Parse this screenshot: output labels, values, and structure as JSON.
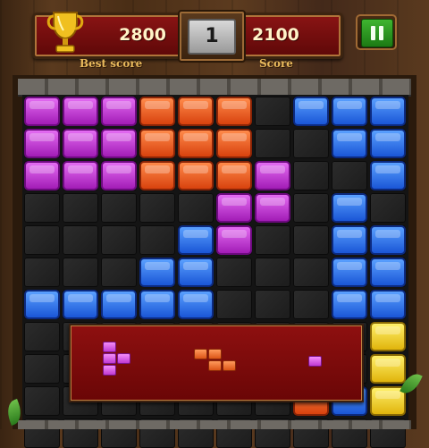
{
  "header": {
    "best_score": "2800",
    "best_label": "Best score",
    "score": "2100",
    "score_label": "Score",
    "level": "1",
    "trophy_icon": "trophy-icon",
    "pause_icon": "pause-icon"
  },
  "colors": {
    "purple": "#c03ad2",
    "orange": "#e85a1e",
    "blue": "#2a6ae6",
    "yellow": "#f0c820",
    "board": "#1c1c1c"
  },
  "board": {
    "columns": 10,
    "rows": 11,
    "blocks": [
      {
        "r": 0,
        "c": 0,
        "color": "purple"
      },
      {
        "r": 0,
        "c": 1,
        "color": "purple"
      },
      {
        "r": 0,
        "c": 2,
        "color": "purple"
      },
      {
        "r": 0,
        "c": 3,
        "color": "orange"
      },
      {
        "r": 0,
        "c": 4,
        "color": "orange"
      },
      {
        "r": 0,
        "c": 5,
        "color": "orange"
      },
      {
        "r": 0,
        "c": 7,
        "color": "blue"
      },
      {
        "r": 0,
        "c": 8,
        "color": "blue"
      },
      {
        "r": 0,
        "c": 9,
        "color": "blue"
      },
      {
        "r": 1,
        "c": 0,
        "color": "purple"
      },
      {
        "r": 1,
        "c": 1,
        "color": "purple"
      },
      {
        "r": 1,
        "c": 2,
        "color": "purple"
      },
      {
        "r": 1,
        "c": 3,
        "color": "orange"
      },
      {
        "r": 1,
        "c": 4,
        "color": "orange"
      },
      {
        "r": 1,
        "c": 5,
        "color": "orange"
      },
      {
        "r": 1,
        "c": 8,
        "color": "blue"
      },
      {
        "r": 1,
        "c": 9,
        "color": "blue"
      },
      {
        "r": 2,
        "c": 0,
        "color": "purple"
      },
      {
        "r": 2,
        "c": 1,
        "color": "purple"
      },
      {
        "r": 2,
        "c": 2,
        "color": "purple"
      },
      {
        "r": 2,
        "c": 3,
        "color": "orange"
      },
      {
        "r": 2,
        "c": 4,
        "color": "orange"
      },
      {
        "r": 2,
        "c": 5,
        "color": "orange"
      },
      {
        "r": 2,
        "c": 6,
        "color": "purple"
      },
      {
        "r": 2,
        "c": 9,
        "color": "blue"
      },
      {
        "r": 3,
        "c": 5,
        "color": "purple"
      },
      {
        "r": 3,
        "c": 6,
        "color": "purple"
      },
      {
        "r": 3,
        "c": 8,
        "color": "blue"
      },
      {
        "r": 4,
        "c": 4,
        "color": "blue"
      },
      {
        "r": 4,
        "c": 5,
        "color": "purple"
      },
      {
        "r": 4,
        "c": 8,
        "color": "blue"
      },
      {
        "r": 4,
        "c": 9,
        "color": "blue"
      },
      {
        "r": 5,
        "c": 3,
        "color": "blue"
      },
      {
        "r": 5,
        "c": 4,
        "color": "blue"
      },
      {
        "r": 5,
        "c": 8,
        "color": "blue"
      },
      {
        "r": 5,
        "c": 9,
        "color": "blue"
      },
      {
        "r": 6,
        "c": 0,
        "color": "blue"
      },
      {
        "r": 6,
        "c": 1,
        "color": "blue"
      },
      {
        "r": 6,
        "c": 2,
        "color": "blue"
      },
      {
        "r": 6,
        "c": 3,
        "color": "blue"
      },
      {
        "r": 6,
        "c": 4,
        "color": "blue"
      },
      {
        "r": 6,
        "c": 8,
        "color": "blue"
      },
      {
        "r": 6,
        "c": 9,
        "color": "blue"
      },
      {
        "r": 7,
        "c": 9,
        "color": "yellow"
      },
      {
        "r": 8,
        "c": 9,
        "color": "yellow"
      },
      {
        "r": 9,
        "c": 9,
        "color": "yellow"
      },
      {
        "r": 9,
        "c": 8,
        "color": "blue"
      },
      {
        "r": 9,
        "c": 7,
        "color": "orange"
      }
    ]
  },
  "tray": {
    "pieces": [
      {
        "name": "piece-t-vertical",
        "color": "purple",
        "cells": [
          [
            0,
            0
          ],
          [
            1,
            0
          ],
          [
            1,
            1
          ],
          [
            2,
            0
          ]
        ]
      },
      {
        "name": "piece-z",
        "color": "orange",
        "cells": [
          [
            0,
            0
          ],
          [
            0,
            1
          ],
          [
            1,
            1
          ],
          [
            1,
            2
          ]
        ]
      },
      {
        "name": "piece-single",
        "color": "purple",
        "cells": [
          [
            0,
            0
          ]
        ]
      }
    ]
  }
}
